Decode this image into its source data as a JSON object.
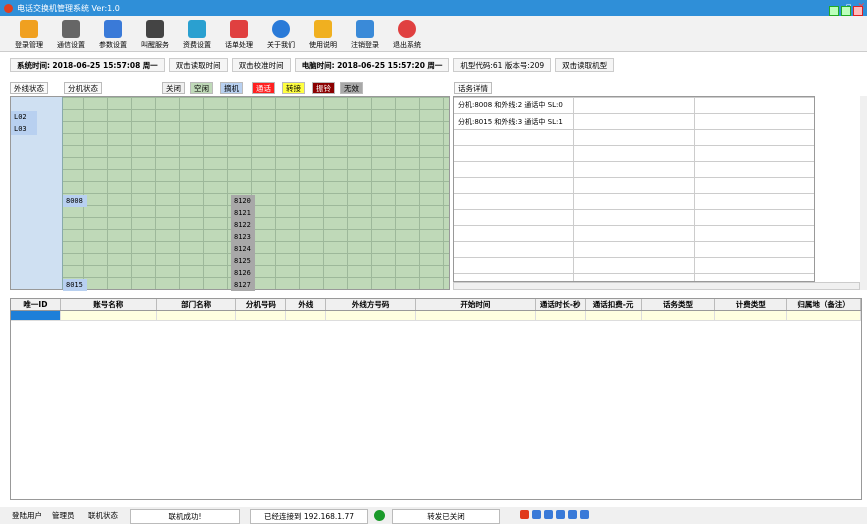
{
  "window": {
    "title": "电话交换机管理系统 Ver:1.0"
  },
  "toolbar": [
    {
      "label": "登录管理",
      "icon": "person-icon",
      "color": "#f0a020"
    },
    {
      "label": "通信设置",
      "icon": "sliders-icon",
      "color": "#666666"
    },
    {
      "label": "参数设置",
      "icon": "settings-icon",
      "color": "#3a7ad8"
    },
    {
      "label": "叫醒服务",
      "icon": "alarm-clock-icon",
      "color": "#444444"
    },
    {
      "label": "资费设置",
      "icon": "money-icon",
      "color": "#2aa0d0"
    },
    {
      "label": "话单处理",
      "icon": "cabinet-icon",
      "color": "#e04040"
    },
    {
      "label": "关于我们",
      "icon": "info-icon",
      "color": "#2a7ad8"
    },
    {
      "label": "使用说明",
      "icon": "document-icon",
      "color": "#f0b020"
    },
    {
      "label": "注销登录",
      "icon": "logout-icon",
      "color": "#3a8ad8"
    },
    {
      "label": "退出系统",
      "icon": "power-icon",
      "color": "#e04040"
    }
  ],
  "infobar": {
    "sys_time_label": "系统时间:",
    "sys_time": "2018-06-25 15:57:08",
    "sys_weekday": "周一",
    "read_time_btn": "双击读取时间",
    "calib_time_btn": "双击校准时间",
    "pc_time_label": "电脑时间:",
    "pc_time": "2018-06-25 15:57:20",
    "pc_weekday": "周一",
    "model_code": "机型代码:61 版本号:209",
    "read_model_btn": "双击读取机型"
  },
  "status_header": {
    "trunk_status": "外线状态",
    "ext_status": "分机状态",
    "legend": [
      {
        "label": "关闭",
        "color": "#f0f0f0"
      },
      {
        "label": "空闲",
        "color": "#bfd9b8"
      },
      {
        "label": "摘机",
        "color": "#b8d0f0"
      },
      {
        "label": "通话",
        "color": "#ff2020"
      },
      {
        "label": "转接",
        "color": "#ffff40"
      },
      {
        "label": "振铃",
        "color": "#8b0000"
      },
      {
        "label": "无效",
        "color": "#a8a8a8"
      }
    ],
    "call_detail": "话务详情"
  },
  "grid": {
    "trunks": [
      "L02",
      "L03"
    ],
    "extensions_col1": [
      "8008",
      "8015"
    ],
    "extensions_col2": [
      "8120",
      "8121",
      "8122",
      "8123",
      "8124",
      "8125",
      "8126",
      "8127"
    ]
  },
  "call_details": [
    "分机:8008 和外线:2 通话中 SL:0",
    "分机:8015 和外线:3 通话中 SL:1"
  ],
  "table": {
    "columns": [
      "唯一ID",
      "账号名称",
      "部门名称",
      "分机号码",
      "外线",
      "外线方号码",
      "开始时间",
      "通话时长-秒",
      "通话扣费-元",
      "话务类型",
      "计费类型",
      "归属地（备注）"
    ]
  },
  "statusbar": {
    "login_user_label": "登陆用户",
    "login_user": "管理员",
    "conn_status_label": "联机状态",
    "conn_result": "联机成功!",
    "connected_to": "已经连接到 192.168.1.77",
    "forward_status": "转发已关闭"
  }
}
